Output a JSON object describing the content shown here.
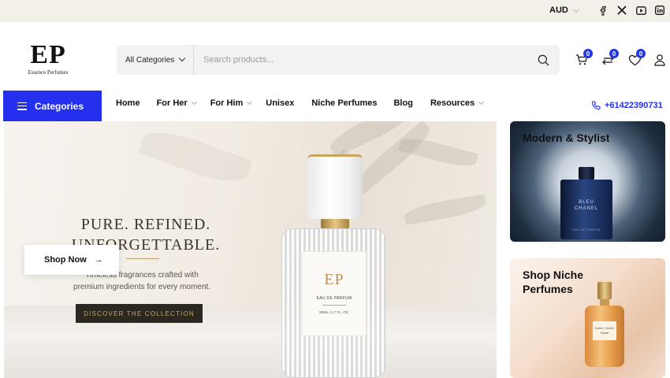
{
  "topbar": {
    "currency": "AUD",
    "social_icons": [
      "facebook-icon",
      "x-icon",
      "youtube-icon",
      "linkedin-icon"
    ]
  },
  "brand": {
    "mark": "EP",
    "tagline": "Essence Perfumes"
  },
  "search": {
    "category_label": "All Categories",
    "placeholder": "Search products..."
  },
  "header_icons": {
    "cart_count": "0",
    "compare_count": "0",
    "wishlist_count": "0"
  },
  "nav": {
    "categories_label": "Categories",
    "items": [
      {
        "label": "Home",
        "has_dropdown": false
      },
      {
        "label": "For Her",
        "has_dropdown": true
      },
      {
        "label": "For Him",
        "has_dropdown": true
      },
      {
        "label": "Unisex",
        "has_dropdown": false
      },
      {
        "label": "Niche Perfumes",
        "has_dropdown": false
      },
      {
        "label": "Blog",
        "has_dropdown": false
      },
      {
        "label": "Resources",
        "has_dropdown": true
      }
    ],
    "phone": "+61422390731"
  },
  "hero": {
    "title_line1": "PURE. REFINED.",
    "title_line2": "UNFORGETTABLE.",
    "subtitle_line1": "Timeless fragrances crafted with",
    "subtitle_line2": "premium ingredients for every moment.",
    "cta_label": "DISCOVER THE COLLECTION",
    "shop_now_label": "Shop Now",
    "bottle_label": {
      "mark": "EP",
      "line1": "EAU DE PARFUM",
      "line2": "50ML | 1.7 FL. OZ."
    }
  },
  "promo_cards": [
    {
      "title": "Modern & Stylist",
      "bottle_text": [
        "BLEU",
        "CHANEL",
        "EAU DE PARFUM"
      ]
    },
    {
      "title_line1": "Shop Niche",
      "title_line2": "Perfumes",
      "bottle_text": [
        "Noble Ondée",
        "Extrait"
      ]
    }
  ],
  "colors": {
    "accent": "#2430ee",
    "topbar_bg": "#f3efe9",
    "gold": "#c9a86a"
  }
}
